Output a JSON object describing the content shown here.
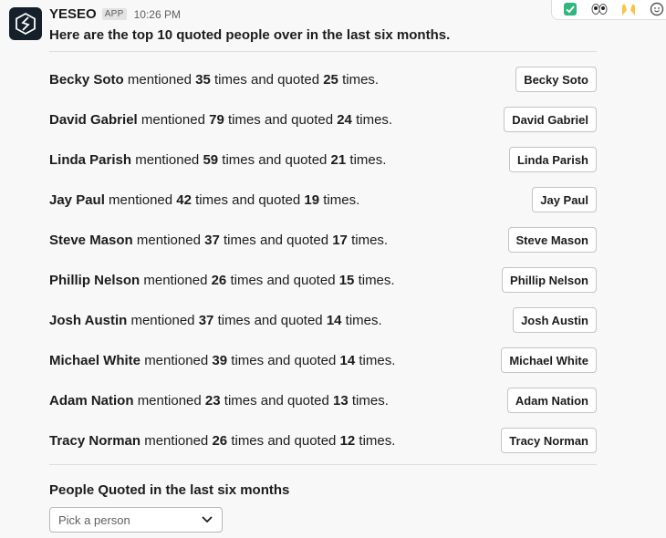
{
  "message": {
    "app_name": "YESEO",
    "badge": "APP",
    "time": "10:26 PM",
    "intro": "Here are the top 10 quoted people over in the last six months."
  },
  "people": [
    {
      "name": "Becky Soto",
      "mentioned": "35",
      "quoted": "25"
    },
    {
      "name": "David Gabriel",
      "mentioned": "79",
      "quoted": "24"
    },
    {
      "name": "Linda Parish",
      "mentioned": "59",
      "quoted": "21"
    },
    {
      "name": "Jay Paul",
      "mentioned": "42",
      "quoted": "19"
    },
    {
      "name": "Steve Mason",
      "mentioned": "37",
      "quoted": "17"
    },
    {
      "name": "Phillip Nelson",
      "mentioned": "26",
      "quoted": "15"
    },
    {
      "name": "Josh Austin",
      "mentioned": "37",
      "quoted": "14"
    },
    {
      "name": "Michael White",
      "mentioned": "39",
      "quoted": "14"
    },
    {
      "name": "Adam Nation",
      "mentioned": "23",
      "quoted": "13"
    },
    {
      "name": "Tracy Norman",
      "mentioned": "26",
      "quoted": "12"
    }
  ],
  "phrases": {
    "mentioned": "mentioned",
    "times_and_quoted": "times and quoted",
    "times_end": "times."
  },
  "section": {
    "title": "People Quoted in the last six months",
    "select_placeholder": "Pick a person"
  },
  "colors": {
    "check_green": "#2eb67d",
    "avatar_bg": "#16202a"
  },
  "reactions": [
    "check-mark-icon",
    "eyes-icon",
    "raised-hands-icon",
    "add-reaction-icon"
  ]
}
